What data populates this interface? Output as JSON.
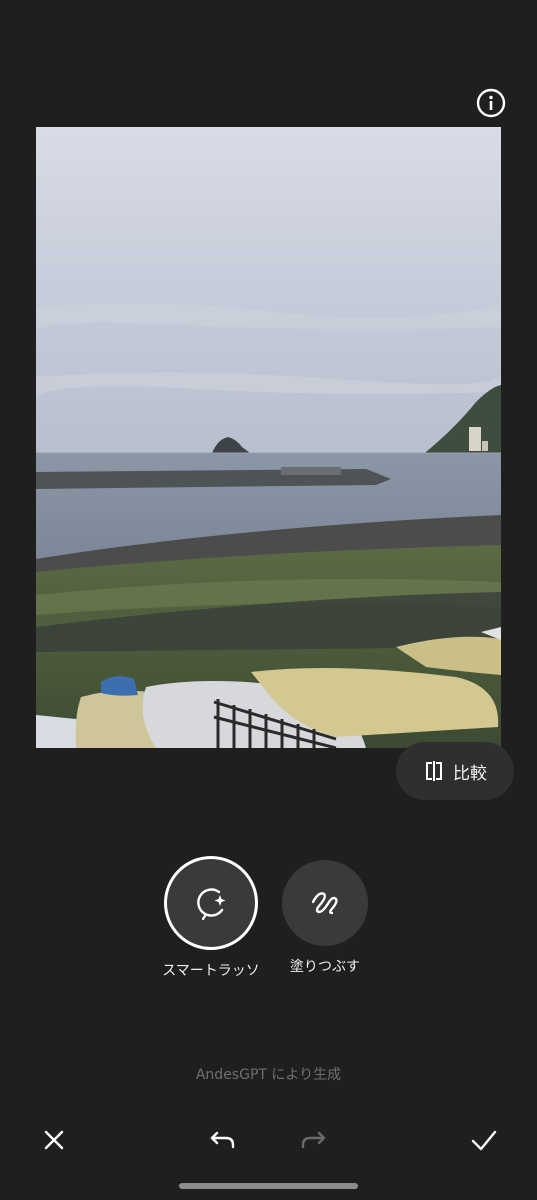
{
  "toolbar": {
    "info_icon": "info-icon"
  },
  "compare": {
    "label": "比較",
    "icon": "compare-icon"
  },
  "tools": [
    {
      "label": "スマートラッソ",
      "icon": "smart-lasso-icon",
      "selected": true
    },
    {
      "label": "塗りつぶす",
      "icon": "brush-scribble-icon",
      "selected": false
    }
  ],
  "credit": "AndesGPT により生成",
  "bottom_bar": {
    "cancel_icon": "close-icon",
    "undo_icon": "undo-icon",
    "redo_icon": "redo-icon",
    "confirm_icon": "check-icon",
    "redo_enabled": false
  },
  "colors": {
    "background": "#1f1f1f",
    "button_bg": "#2f2f2f",
    "tool_bg": "#3a3a3a",
    "muted_text": "#6f6f6f"
  }
}
